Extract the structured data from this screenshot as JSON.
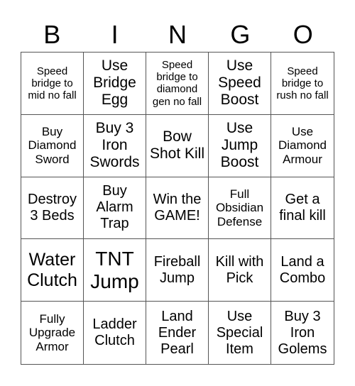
{
  "header": [
    "B",
    "I",
    "N",
    "G",
    "O"
  ],
  "cells": [
    {
      "text": "Speed bridge to mid no fall",
      "size": "s-xs"
    },
    {
      "text": "Use Bridge Egg",
      "size": "s-lg"
    },
    {
      "text": "Speed bridge to diamond gen no fall",
      "size": "s-xs"
    },
    {
      "text": "Use Speed Boost",
      "size": "s-lg"
    },
    {
      "text": "Speed bridge to rush no fall",
      "size": "s-xs"
    },
    {
      "text": "Buy Diamond Sword",
      "size": "s-sm"
    },
    {
      "text": "Buy 3 Iron Swords",
      "size": "s-lg"
    },
    {
      "text": "Bow Shot Kill",
      "size": "s-lg"
    },
    {
      "text": "Use Jump Boost",
      "size": "s-lg"
    },
    {
      "text": "Use Diamond Armour",
      "size": "s-sm"
    },
    {
      "text": "Destroy 3 Beds",
      "size": "s-md"
    },
    {
      "text": "Buy Alarm Trap",
      "size": "s-md"
    },
    {
      "text": "Win the GAME!",
      "size": "s-md"
    },
    {
      "text": "Full Obsidian Defense",
      "size": "s-sm"
    },
    {
      "text": "Get a final kill",
      "size": "s-md"
    },
    {
      "text": "Water Clutch",
      "size": "s-xl"
    },
    {
      "text": "TNT Jump",
      "size": "s-xxl"
    },
    {
      "text": "Fireball Jump",
      "size": "s-md"
    },
    {
      "text": "Kill with Pick",
      "size": "s-md"
    },
    {
      "text": "Land a Combo",
      "size": "s-md"
    },
    {
      "text": "Fully Upgrade Armor",
      "size": "s-sm"
    },
    {
      "text": "Ladder Clutch",
      "size": "s-md"
    },
    {
      "text": "Land Ender Pearl",
      "size": "s-md"
    },
    {
      "text": "Use Special Item",
      "size": "s-md"
    },
    {
      "text": "Buy 3 Iron Golems",
      "size": "s-md"
    }
  ]
}
